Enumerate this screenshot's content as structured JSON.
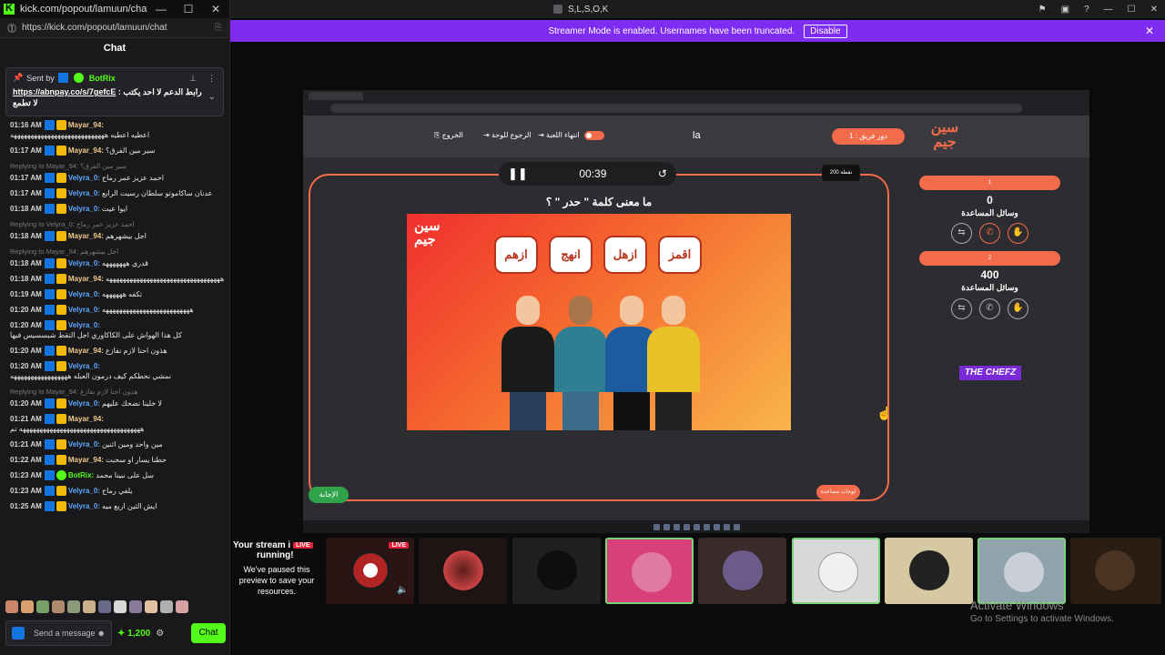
{
  "chat_window": {
    "title": "kick.com/popout/lamuun/chat -...",
    "url": "https://kick.com/popout/lamuun/chat",
    "header": "Chat",
    "pinned": {
      "sent_by_label": "Sent by",
      "sender": "BotRix",
      "message_link": "https://abnpay.co/s/7gefcE",
      "message_text": ": رابط الدعم لا احد يكتب",
      "message_tail": "لا تطمع"
    },
    "messages": [
      {
        "ts": "01:16 AM",
        "user": "Mayar_94:",
        "color": "#f3c98b",
        "badges": [
          "mod",
          "crown"
        ],
        "text": "اعطيه اعطيه ههههههههههههههههههههههههههههه"
      },
      {
        "ts": "01:17 AM",
        "user": "Mayar_94:",
        "color": "#f3c98b",
        "badges": [
          "mod",
          "crown"
        ],
        "text": "سير مين الفرق؟"
      },
      {
        "reply": "Replying to Mayar_94: سير مين الفرق؟",
        "ts": "01:17 AM",
        "user": "Velyra_0:",
        "color": "#5fa8ff",
        "badges": [
          "mod",
          "crown"
        ],
        "text": "احمد عزيز عمر رماح"
      },
      {
        "ts": "01:17 AM",
        "user": "Velyra_0:",
        "color": "#5fa8ff",
        "badges": [
          "mod",
          "crown"
        ],
        "text": "عدنان ساكاموتو سلطان رسيت الرابع"
      },
      {
        "ts": "01:18 AM",
        "user": "Velyra_0:",
        "color": "#5fa8ff",
        "badges": [
          "mod",
          "crown"
        ],
        "text": "ايوا عيت"
      },
      {
        "reply": "Replying to Velyra_0: احمد عزيز عمر رماح",
        "ts": "01:18 AM",
        "user": "Mayar_94:",
        "color": "#f3c98b",
        "badges": [
          "mod",
          "crown"
        ],
        "text": "اجل بيشهرهم"
      },
      {
        "reply": "Replying to Mayar_94: اجل بيشهرهم",
        "ts": "01:18 AM",
        "user": "Velyra_0:",
        "color": "#5fa8ff",
        "badges": [
          "mod",
          "crown"
        ],
        "text": "قدري هههههههه"
      },
      {
        "ts": "01:18 AM",
        "user": "Mayar_94:",
        "color": "#f3c98b",
        "badges": [
          "mod",
          "crown"
        ],
        "text": "ههههههههههههههههههههههههههههههههههه"
      },
      {
        "ts": "01:19 AM",
        "user": "Velyra_0:",
        "color": "#5fa8ff",
        "badges": [
          "mod",
          "crown"
        ],
        "text": "تكفه ههههههه"
      },
      {
        "ts": "01:20 AM",
        "user": "Velyra_0:",
        "color": "#5fa8ff",
        "badges": [
          "mod",
          "crown"
        ],
        "text": "ههههههههههههههههههههههههههه"
      },
      {
        "ts": "01:20 AM",
        "user": "Velyra_0:",
        "color": "#5fa8ff",
        "badges": [
          "mod",
          "crown"
        ],
        "text": "كل هذا الهواش على الكاكاوري اجل التقط شبسسيس فيها"
      },
      {
        "ts": "01:20 AM",
        "user": "Mayar_94:",
        "color": "#f3c98b",
        "badges": [
          "mod",
          "crown"
        ],
        "text": "هذون احنا لازم نفازع"
      },
      {
        "ts": "01:20 AM",
        "user": "Velyra_0:",
        "color": "#5fa8ff",
        "badges": [
          "mod",
          "crown"
        ],
        "text": "نمشي نحطكم كيف درمون العبله هههههههههههههههههه"
      },
      {
        "reply": "Replying to Mayar_94: هذون احنا لازم نفازع",
        "ts": "01:20 AM",
        "user": "Velyra_0:",
        "color": "#5fa8ff",
        "badges": [
          "mod",
          "crown"
        ],
        "text": "لا خلينا نضحك عليهم"
      },
      {
        "ts": "01:21 AM",
        "user": "Mayar_94:",
        "color": "#f3c98b",
        "badges": [
          "mod",
          "crown"
        ],
        "text": "ههههههههههههههههههههههههههههههههههههه تم"
      },
      {
        "ts": "01:21 AM",
        "user": "Velyra_0:",
        "color": "#5fa8ff",
        "badges": [
          "mod",
          "crown"
        ],
        "text": "مين واحد ومين اثنين"
      },
      {
        "ts": "01:22 AM",
        "user": "Mayar_94:",
        "color": "#f3c98b",
        "badges": [
          "mod",
          "crown"
        ],
        "text": "حطنا يسار او سحبت"
      },
      {
        "ts": "01:23 AM",
        "user": "BotRix:",
        "color": "#53fc18",
        "badges": [
          "mod",
          "bot"
        ],
        "text": "سل على نبينا محمد"
      },
      {
        "ts": "01:23 AM",
        "user": "Velyra_0:",
        "color": "#5fa8ff",
        "badges": [
          "mod",
          "crown"
        ],
        "text": "يلفي رماح"
      },
      {
        "ts": "01:25 AM",
        "user": "Velyra_0:",
        "color": "#5fa8ff",
        "badges": [
          "mod",
          "crown"
        ],
        "text": "ايش الثين اربع ميه"
      }
    ],
    "input_placeholder": "Send a message",
    "points": "1,200",
    "chat_button": "Chat"
  },
  "top_bar": {
    "title": "S,L,S,O,K"
  },
  "banner": {
    "text": "Streamer Mode is enabled. Usernames have been truncated.",
    "disable": "Disable"
  },
  "game": {
    "header": {
      "exit": "الخروج",
      "back_board": "الرجوع للوحة",
      "end_game": "انتهاء اللعبة",
      "la": "la",
      "team_turn": "دور فريق : 1"
    },
    "timer": "00:39",
    "points_badge": "200 نقطة",
    "question": "ما معنى كلمة \" حدر \" ؟",
    "options": [
      "اقمز",
      "ازهل",
      "انهج",
      "ازهم"
    ],
    "hint_label": "لوحات مساعدة",
    "answer_button": "الإجابة",
    "teams": [
      {
        "name": "1",
        "score": "0",
        "help": "وسائل المساعدة"
      },
      {
        "name": "2",
        "score": "400",
        "help": "وسائل المساعدة"
      }
    ],
    "sponsor": "THE CHEFZ"
  },
  "bottom": {
    "paused_title": "Your stream i",
    "paused_live": "LIVE",
    "paused_running": "running!",
    "paused_text": "We've paused this preview to save your resources.",
    "thumb_live": "LIVE"
  },
  "activate": {
    "title": "Activate Windows",
    "sub": "Go to Settings to activate Windows."
  }
}
